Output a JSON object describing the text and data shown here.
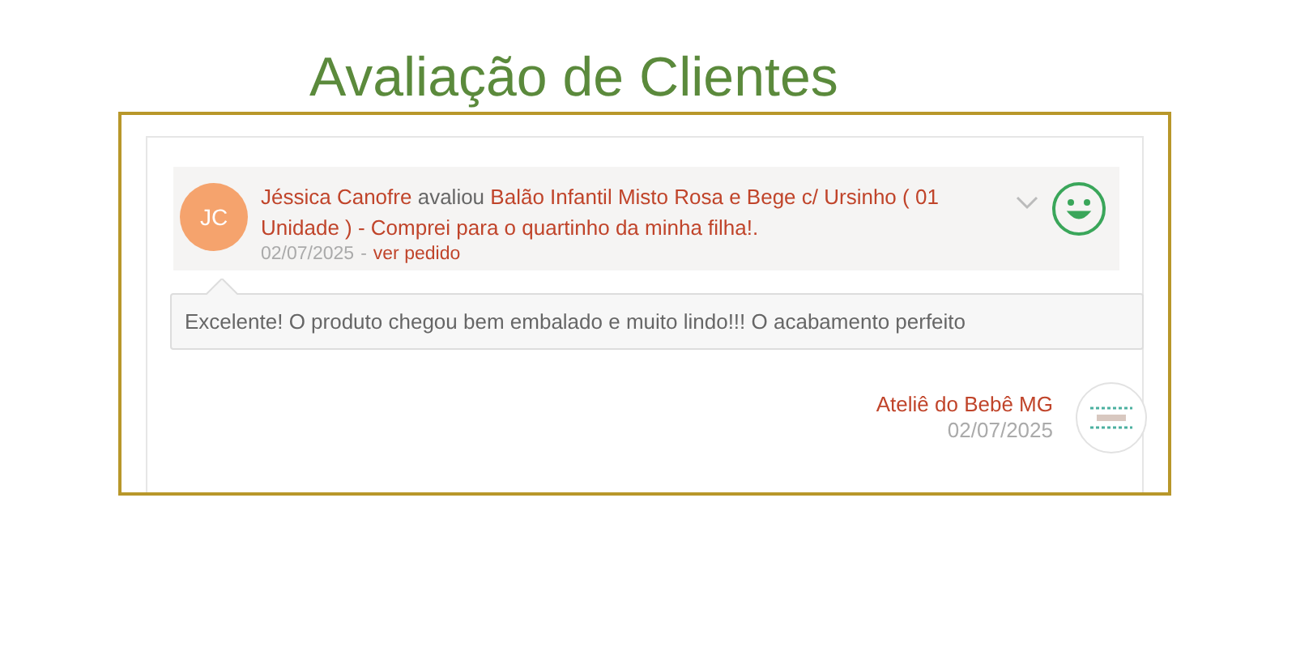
{
  "title": "Avaliação de Clientes",
  "review": {
    "avatar_initials": "JC",
    "reviewer": "Jéssica Canofre",
    "action": "avaliou",
    "product": "Balão Infantil Misto Rosa e Bege c/ Ursinho ( 01 Unidade ) - Comprei para o quartinho da minha filha!.",
    "date": "02/07/2025",
    "separator": "-",
    "order_link": "ver pedido",
    "expanded": false,
    "rating": {
      "kind": "positive"
    },
    "comment": "Excelente! O produto chegou bem embalado e muito lindo!!! O acabamento perfeito",
    "reply": {
      "seller": "Ateliê do Bebê MG",
      "date": "02/07/2025"
    }
  }
}
